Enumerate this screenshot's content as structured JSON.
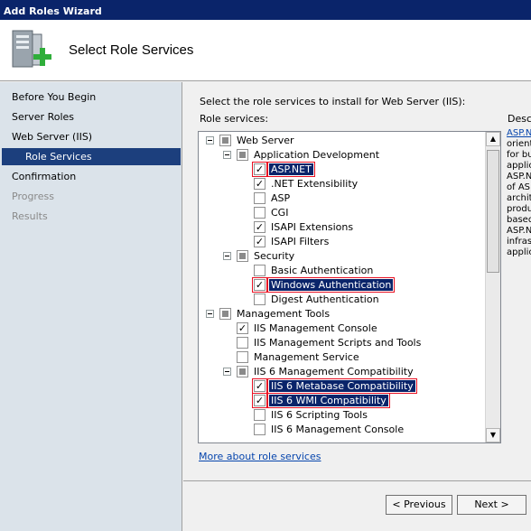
{
  "window": {
    "title": "Add Roles Wizard"
  },
  "header": {
    "title": "Select Role Services",
    "icon": "server-add-icon"
  },
  "nav": {
    "items": [
      {
        "label": "Before You Begin",
        "state": "normal"
      },
      {
        "label": "Server Roles",
        "state": "normal"
      },
      {
        "label": "Web Server (IIS)",
        "state": "normal"
      },
      {
        "label": "Role Services",
        "state": "selected"
      },
      {
        "label": "Confirmation",
        "state": "normal"
      },
      {
        "label": "Progress",
        "state": "disabled"
      },
      {
        "label": "Results",
        "state": "disabled"
      }
    ]
  },
  "main": {
    "instruction": "Select the role services to install for Web Server (IIS):",
    "role_services_label": "Role services:",
    "description_label": "Descr",
    "description_lines": [
      "ASP.N",
      "orient",
      "for bu",
      "applic",
      "ASP.N",
      "of AS",
      "archit",
      "produ",
      "based",
      "ASP.N",
      "infras",
      "applic"
    ],
    "more_link": "More about role services"
  },
  "tree": [
    {
      "label": "Web Server",
      "state": "partial",
      "level": 0,
      "expander": true,
      "highlight": false
    },
    {
      "label": "Application Development",
      "state": "partial",
      "level": 1,
      "expander": true,
      "highlight": false
    },
    {
      "label": "ASP.NET",
      "state": "checked",
      "level": 2,
      "expander": false,
      "highlight": true
    },
    {
      "label": ".NET Extensibility",
      "state": "checked",
      "level": 2,
      "expander": false,
      "highlight": false
    },
    {
      "label": "ASP",
      "state": "unchecked",
      "level": 2,
      "expander": false,
      "highlight": false
    },
    {
      "label": "CGI",
      "state": "unchecked",
      "level": 2,
      "expander": false,
      "highlight": false
    },
    {
      "label": "ISAPI Extensions",
      "state": "checked",
      "level": 2,
      "expander": false,
      "highlight": false
    },
    {
      "label": "ISAPI Filters",
      "state": "checked",
      "level": 2,
      "expander": false,
      "highlight": false
    },
    {
      "label": "Security",
      "state": "partial",
      "level": 1,
      "expander": true,
      "highlight": false
    },
    {
      "label": "Basic Authentication",
      "state": "unchecked",
      "level": 2,
      "expander": false,
      "highlight": false
    },
    {
      "label": "Windows Authentication",
      "state": "checked",
      "level": 2,
      "expander": false,
      "highlight": true
    },
    {
      "label": "Digest Authentication",
      "state": "unchecked",
      "level": 2,
      "expander": false,
      "highlight": false
    },
    {
      "label": "Management Tools",
      "state": "partial",
      "level": 0,
      "expander": true,
      "highlight": false
    },
    {
      "label": "IIS Management Console",
      "state": "checked",
      "level": 1,
      "expander": false,
      "highlight": false
    },
    {
      "label": "IIS Management Scripts and Tools",
      "state": "unchecked",
      "level": 1,
      "expander": false,
      "highlight": false
    },
    {
      "label": "Management Service",
      "state": "unchecked",
      "level": 1,
      "expander": false,
      "highlight": false
    },
    {
      "label": "IIS 6 Management Compatibility",
      "state": "partial",
      "level": 1,
      "expander": true,
      "highlight": false
    },
    {
      "label": "IIS 6 Metabase Compatibility",
      "state": "checked",
      "level": 2,
      "expander": false,
      "highlight": true
    },
    {
      "label": "IIS 6 WMI Compatibility",
      "state": "checked",
      "level": 2,
      "expander": false,
      "highlight": true
    },
    {
      "label": "IIS 6 Scripting Tools",
      "state": "unchecked",
      "level": 2,
      "expander": false,
      "highlight": false
    },
    {
      "label": "IIS 6 Management Console",
      "state": "unchecked",
      "level": 2,
      "expander": false,
      "highlight": false
    }
  ],
  "buttons": {
    "previous": "< Previous",
    "next": "Next >"
  },
  "colors": {
    "title_bar": "#0a246a",
    "nav_selected": "#1c3f7d",
    "highlight_border": "#e81123",
    "link": "#0645ad"
  }
}
